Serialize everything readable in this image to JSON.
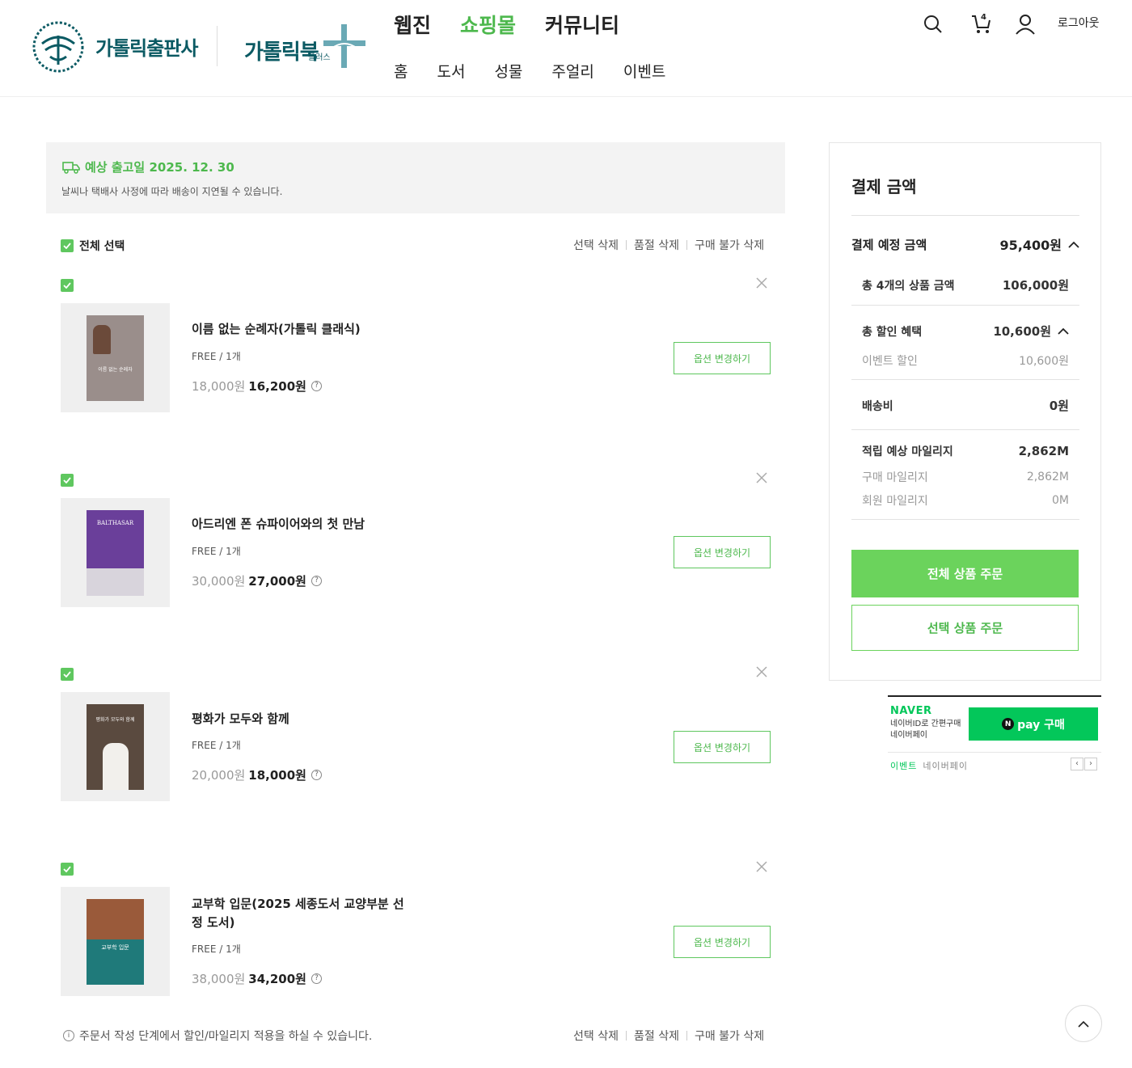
{
  "header": {
    "logo_main": "가톨릭출판사",
    "logo_book": "가톨릭북",
    "logo_book_plus": "플러스",
    "gnb": [
      {
        "label": "웹진"
      },
      {
        "label": "쇼핑몰"
      },
      {
        "label": "커뮤니티"
      }
    ],
    "snb": [
      {
        "label": "홈"
      },
      {
        "label": "도서"
      },
      {
        "label": "성물"
      },
      {
        "label": "주얼리"
      },
      {
        "label": "이벤트"
      }
    ],
    "cart_count": "4",
    "logout": "로그아웃",
    "accent": "#4db84d"
  },
  "notice": {
    "ship_date": "예상 출고일 2025. 12. 30",
    "sub": "날씨나 택배사 사정에 따라 배송이 지연될 수 있습니다."
  },
  "list": {
    "select_all": "전체 선택",
    "del_selected": "선택 삭제",
    "del_soldout": "품절 삭제",
    "del_unavailable": "구매 불가 삭제",
    "items": [
      {
        "name": "이름 없는 순례자(가톨릭 클래식)",
        "option": "FREE / 1개",
        "org_price": "18,000원",
        "sale_price": "16,200원",
        "option_btn": "옵션 변경하기",
        "cover_title": "이름 없는 순례자"
      },
      {
        "name": "아드리엔 폰 슈파이어와의 첫 만남",
        "option": "FREE / 1개",
        "org_price": "30,000원",
        "sale_price": "27,000원",
        "option_btn": "옵션 변경하기",
        "cover_title": "BALTHASAR"
      },
      {
        "name": "평화가 모두와 함께",
        "option": "FREE / 1개",
        "org_price": "20,000원",
        "sale_price": "18,000원",
        "option_btn": "옵션 변경하기",
        "cover_title": "평화가 모두와 함께"
      },
      {
        "name": "교부학 입문(2025 세종도서 교양부분 선정 도서)",
        "option": "FREE / 1개",
        "org_price": "38,000원",
        "sale_price": "34,200원",
        "option_btn": "옵션 변경하기",
        "cover_title": "교부학 입문"
      }
    ],
    "info": "주문서 작성 단계에서 할인/마일리지 적용을 하실 수 있습니다."
  },
  "summary": {
    "title": "결제 금액",
    "expected_label": "결제 예정 금액",
    "expected_value": "95,400원",
    "goods_label": "총 4개의 상품 금액",
    "goods_value": "106,000원",
    "discount_label": "총 할인 혜택",
    "discount_value": "10,600원",
    "event_label": "이벤트 할인",
    "event_value": "10,600원",
    "ship_label": "배송비",
    "ship_value": "0원",
    "mileage_label": "적립 예상 마일리지",
    "mileage_value": "2,862M",
    "buy_mileage_label": "구매 마일리지",
    "buy_mileage_value": "2,862M",
    "member_mileage_label": "회원 마일리지",
    "member_mileage_value": "0M",
    "order_all": "전체 상품 주문",
    "order_selected": "선택 상품 주문"
  },
  "naver": {
    "logo": "NAVER",
    "desc": "네이버ID로 간편구매 네이버페이",
    "pay_btn": "pay 구매",
    "event": "이벤트",
    "event_sub": "네이버페이"
  }
}
